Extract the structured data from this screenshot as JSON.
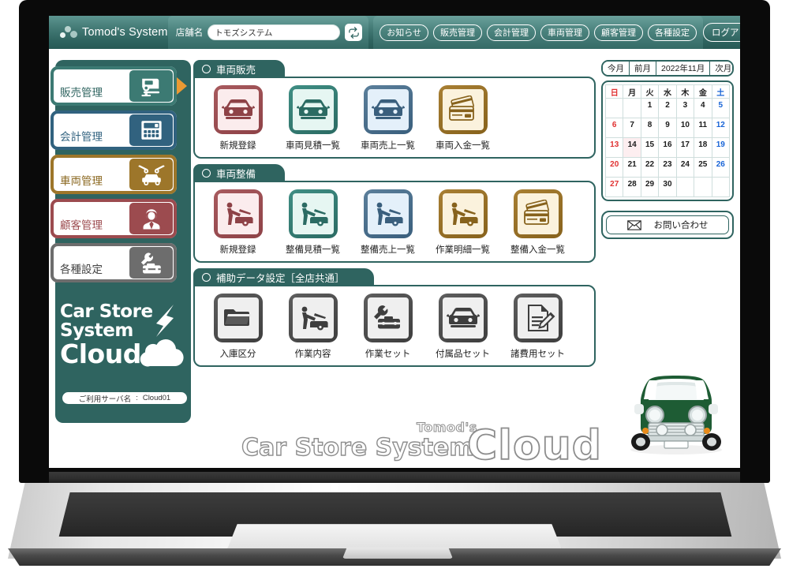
{
  "header": {
    "brand": "Tomod's System",
    "store_label": "店舗名",
    "store_value": "トモズシステム",
    "store_placeholder": "店舗名",
    "refresh_icon": "refresh-icon",
    "nav": [
      {
        "label": "お知らせ"
      },
      {
        "label": "販売管理"
      },
      {
        "label": "会計管理"
      },
      {
        "label": "車両管理"
      },
      {
        "label": "顧客管理"
      },
      {
        "label": "各種設定"
      }
    ],
    "logout": "ログアウト"
  },
  "sidebar": {
    "items": [
      {
        "label": "販売管理",
        "color": "#3c7a73",
        "icon": "car-sale-icon",
        "active": true
      },
      {
        "label": "会計管理",
        "color": "#31627f",
        "icon": "calculator-icon",
        "active": false
      },
      {
        "label": "車両管理",
        "color": "#9d762a",
        "icon": "car-lift-icon",
        "active": false
      },
      {
        "label": "顧客管理",
        "color": "#9c4b4f",
        "icon": "customer-icon",
        "active": false
      },
      {
        "label": "各種設定",
        "color": "#6d6d6d",
        "icon": "toolbox-wrench-icon",
        "active": false
      }
    ],
    "logo": {
      "line1": "Car Store",
      "line2": "System",
      "line3": "Cloud"
    },
    "server": {
      "label": "ご利用サーバ名",
      "separator": ":",
      "value": "Cloud01"
    }
  },
  "main": {
    "sections": [
      {
        "title": "車両販売",
        "tiles": [
          {
            "label": "新規登録",
            "theme": "t-red",
            "icon": "car-front-icon"
          },
          {
            "label": "車両見積一覧",
            "theme": "t-green",
            "icon": "car-front-icon"
          },
          {
            "label": "車両売上一覧",
            "theme": "t-blue",
            "icon": "car-front-icon"
          },
          {
            "label": "車両入金一覧",
            "theme": "t-gold",
            "icon": "credit-cards-icon"
          }
        ]
      },
      {
        "title": "車両整備",
        "tiles": [
          {
            "label": "新規登録",
            "theme": "t-red",
            "icon": "mechanic-icon"
          },
          {
            "label": "整備見積一覧",
            "theme": "t-green",
            "icon": "mechanic-icon"
          },
          {
            "label": "整備売上一覧",
            "theme": "t-blue",
            "icon": "mechanic-icon"
          },
          {
            "label": "作業明細一覧",
            "theme": "t-gold",
            "icon": "mechanic-icon"
          },
          {
            "label": "整備入金一覧",
            "theme": "t-gold",
            "icon": "credit-cards-icon"
          }
        ]
      },
      {
        "title": "補助データ設定［全店共通］",
        "tiles": [
          {
            "label": "入庫区分",
            "theme": "t-gray",
            "icon": "folder-icon"
          },
          {
            "label": "作業内容",
            "theme": "t-gray",
            "icon": "mechanic-icon"
          },
          {
            "label": "作業セット",
            "theme": "t-gray",
            "icon": "toolbox-wrench-icon"
          },
          {
            "label": "付属品セット",
            "theme": "t-gray",
            "icon": "car-front-icon"
          },
          {
            "label": "諸費用セット",
            "theme": "t-gray",
            "icon": "document-pen-icon"
          }
        ]
      }
    ]
  },
  "calendar": {
    "nav": {
      "this_month": "今月",
      "prev_month": "前月",
      "title": "2022年11月",
      "next_month": "次月"
    },
    "weekdays": [
      "日",
      "月",
      "火",
      "水",
      "木",
      "金",
      "土"
    ],
    "weeks": [
      [
        "",
        "",
        "1",
        "2",
        "3",
        "4",
        "5"
      ],
      [
        "6",
        "7",
        "8",
        "9",
        "10",
        "11",
        "12"
      ],
      [
        "13",
        "14",
        "15",
        "16",
        "17",
        "18",
        "19"
      ],
      [
        "20",
        "21",
        "22",
        "23",
        "24",
        "25",
        "26"
      ],
      [
        "27",
        "28",
        "29",
        "30",
        "",
        "",
        ""
      ]
    ],
    "today": "14",
    "sunday_color": "#e03131",
    "saturday_color": "#1864d6",
    "today_bg": "#fdeef0"
  },
  "contact": {
    "label": "お問い合わせ",
    "icon": "mail-icon"
  },
  "wordmark": {
    "tomods": "Tomod's",
    "title": "Car Store System",
    "cloud": "Cloud"
  },
  "theme": {
    "primary": "#2f6460",
    "accent_arrow": "#eb9a33"
  }
}
